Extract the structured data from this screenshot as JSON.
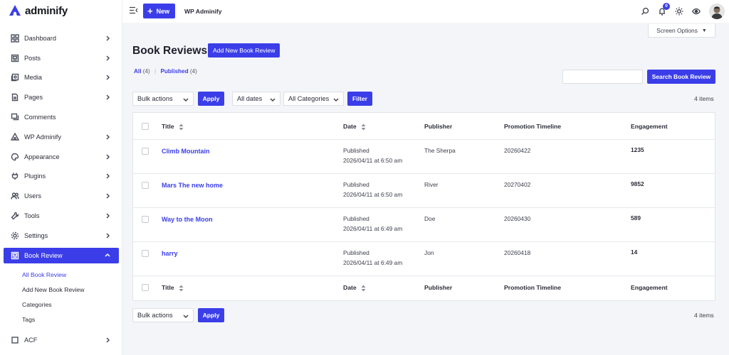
{
  "brand": {
    "name": "adminify",
    "accent": "#3b3ee8"
  },
  "sidebar": {
    "items": [
      {
        "label": "Dashboard",
        "icon": "dashboard-icon"
      },
      {
        "label": "Posts",
        "icon": "posts-icon"
      },
      {
        "label": "Media",
        "icon": "media-icon"
      },
      {
        "label": "Pages",
        "icon": "pages-icon"
      },
      {
        "label": "Comments",
        "icon": "comments-icon"
      },
      {
        "label": "WP Adminify",
        "icon": "adminify-icon"
      },
      {
        "label": "Appearance",
        "icon": "appearance-icon"
      },
      {
        "label": "Plugins",
        "icon": "plugins-icon"
      },
      {
        "label": "Users",
        "icon": "users-icon"
      },
      {
        "label": "Tools",
        "icon": "tools-icon"
      },
      {
        "label": "Settings",
        "icon": "settings-icon"
      }
    ],
    "active": {
      "label": "Book Review",
      "icon": "book-icon"
    },
    "submenu": [
      "All Book Review",
      "Add New Book Review",
      "Categories",
      "Tags"
    ],
    "acf": {
      "label": "ACF"
    }
  },
  "topbar": {
    "new_label": "New",
    "site_name": "WP Adminify",
    "notification_count": "0"
  },
  "screen_options": "Screen Options",
  "page": {
    "title": "Book Reviews",
    "add_new": "Add New Book Review",
    "filters": {
      "all_label": "All",
      "all_count": "(4)",
      "published_label": "Published",
      "published_count": "(4)"
    },
    "search_button": "Search Book Review",
    "search_value": "",
    "bulk_actions": "Bulk actions",
    "apply": "Apply",
    "all_dates": "All dates",
    "all_categories": "All Categories",
    "filter": "Filter",
    "items_count": "4 items"
  },
  "table": {
    "headers": {
      "title": "Title",
      "date": "Date",
      "publisher": "Publisher",
      "promotion": "Promotion Timeline",
      "engagement": "Engagement"
    },
    "rows": [
      {
        "title": "Climb Mountain",
        "status": "Published",
        "date": "2026/04/11 at 6:50 am",
        "publisher": "The Sherpa",
        "promotion": "20260422",
        "engagement": "1235"
      },
      {
        "title": "Mars The new home",
        "status": "Published",
        "date": "2026/04/11 at 6:50 am",
        "publisher": "River",
        "promotion": "20270402",
        "engagement": "9852"
      },
      {
        "title": "Way to the Moon",
        "status": "Published",
        "date": "2026/04/11 at 6:49 am",
        "publisher": "Doe",
        "promotion": "20260430",
        "engagement": "589"
      },
      {
        "title": "harry",
        "status": "Published",
        "date": "2026/04/11 at 6:49 am",
        "publisher": "Jon",
        "promotion": "20260418",
        "engagement": "14"
      }
    ]
  }
}
